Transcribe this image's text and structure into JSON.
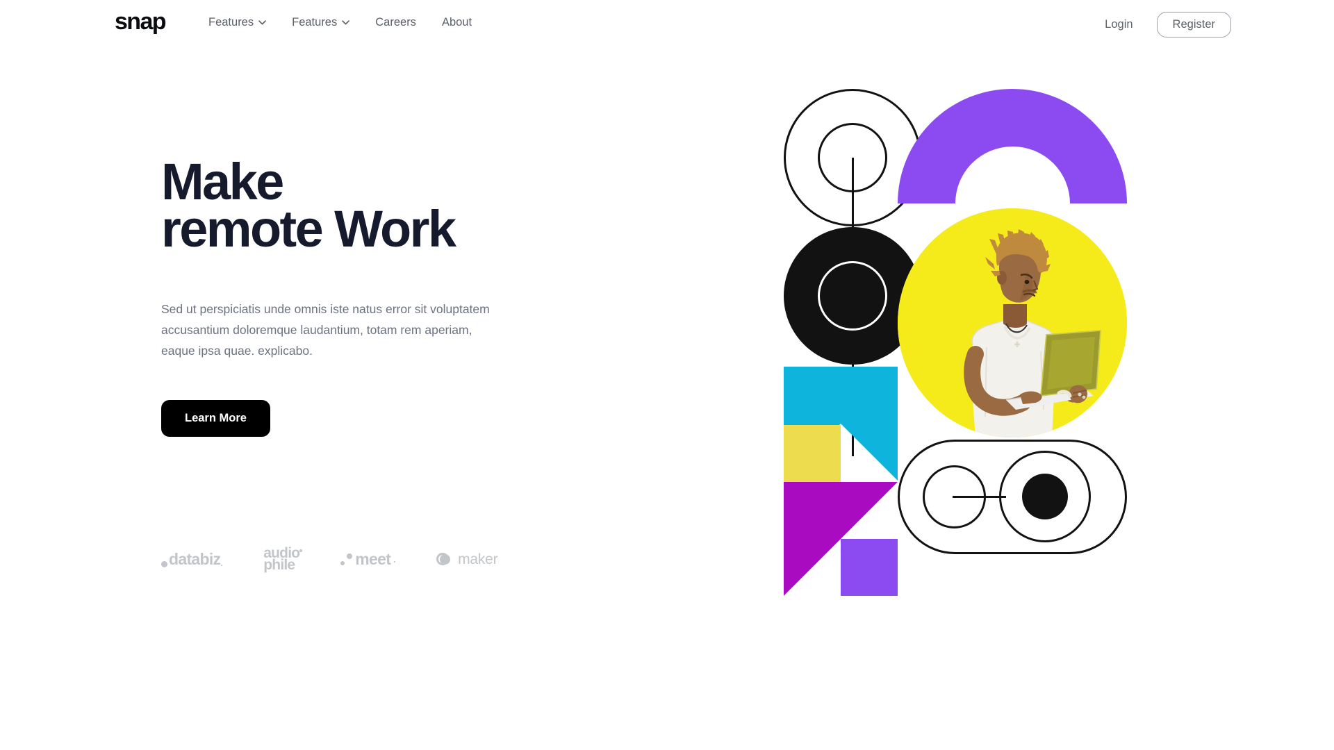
{
  "brand": {
    "name": "snap"
  },
  "nav": {
    "items": [
      {
        "label": "Features",
        "has_dropdown": true,
        "icon": "chevron-down-icon"
      },
      {
        "label": "Features",
        "has_dropdown": true,
        "icon": "chevron-down-icon"
      },
      {
        "label": "Careers",
        "has_dropdown": false,
        "icon": ""
      },
      {
        "label": "About",
        "has_dropdown": false,
        "icon": ""
      }
    ],
    "login_label": "Login",
    "register_label": "Register"
  },
  "hero": {
    "headline": "Make\nremote Work",
    "paragraph": "Sed ut perspiciatis unde omnis iste natus error sit voluptatem accusantium doloremque laudantium, totam rem aperiam, eaque ipsa quae. explicabo.",
    "cta_label": "Learn More"
  },
  "clients": [
    {
      "name": "databiz",
      "label": "databiz",
      "tick": "."
    },
    {
      "name": "audiophile",
      "line1": "audio",
      "line2": "phile"
    },
    {
      "name": "meet",
      "label": "meet",
      "tick": "."
    },
    {
      "name": "maker",
      "label": "maker"
    }
  ],
  "artwork": {
    "alt": "Man with blonde dreadlocks in a white t-shirt holding a laptop on a yellow circular background, surrounded by geometric shapes",
    "colors": {
      "purple": "#8B4BF0",
      "yellow_bright": "#F5EB1B",
      "yellow_soft": "#EDDC4E",
      "cyan": "#0FB4DC",
      "magenta": "#A80BC0",
      "ink": "#121212"
    }
  },
  "theme": {
    "heading_color": "#151A2D",
    "body_color": "#6B7280",
    "button_bg": "#000000",
    "button_text": "#FFFFFF",
    "logo_gray": "#C2C5C9",
    "background": "#FFFFFF"
  }
}
